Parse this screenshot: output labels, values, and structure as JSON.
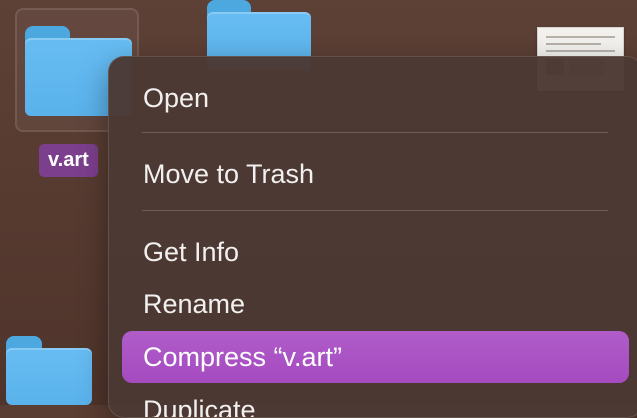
{
  "desktop": {
    "selected_file_label": "v.art"
  },
  "context_menu": {
    "items": [
      {
        "label": "Open"
      },
      {
        "label": "Move to Trash"
      },
      {
        "label": "Get Info"
      },
      {
        "label": "Rename"
      },
      {
        "label": "Compress “v.art”"
      },
      {
        "label": "Duplicate"
      }
    ]
  },
  "icons": {
    "folder": "folder-icon",
    "document": "document-thumbnail-icon"
  },
  "colors": {
    "desktop_background": "#573b31",
    "menu_background": "#4c3934",
    "highlight": "#a54bc0",
    "label_background": "#7c3f8d",
    "folder_blue": "#5ab2eb"
  }
}
